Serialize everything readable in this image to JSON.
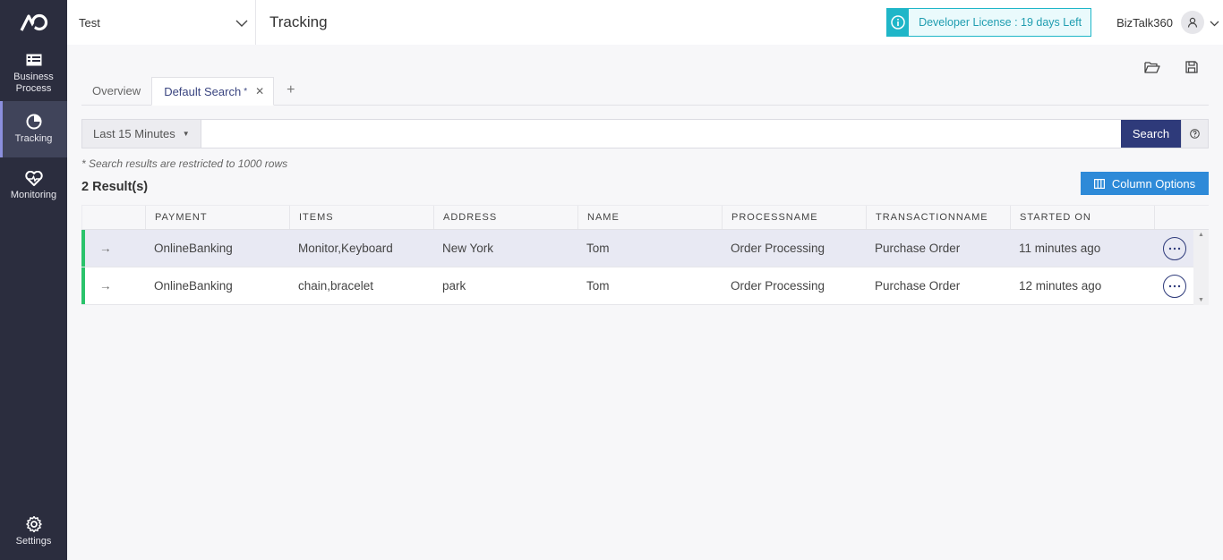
{
  "sidebar": {
    "items": [
      {
        "label": "Business Process",
        "icon": "business-process-icon",
        "active": false
      },
      {
        "label": "Tracking",
        "icon": "tracking-icon",
        "active": true
      },
      {
        "label": "Monitoring",
        "icon": "monitoring-icon",
        "active": false
      }
    ],
    "settings_label": "Settings"
  },
  "header": {
    "environment": "Test",
    "title": "Tracking",
    "license": "Developer License : 19 days Left",
    "user": "BizTalk360"
  },
  "tabs": {
    "overview": "Overview",
    "default_search": "Default Search",
    "modified_marker": "*",
    "add": "+"
  },
  "search": {
    "time_range": "Last 15 Minutes",
    "query": "",
    "button": "Search"
  },
  "note": "* Search results are restricted to 1000 rows",
  "results_count": "2 Result(s)",
  "column_options_label": "Column Options",
  "table": {
    "columns": [
      "PAYMENT",
      "ITEMS",
      "ADDRESS",
      "NAME",
      "PROCESSNAME",
      "TRANSACTIONNAME",
      "STARTED ON"
    ],
    "rows": [
      [
        "OnlineBanking",
        "Monitor,Keyboard",
        "New York",
        "Tom",
        "Order Processing",
        "Purchase Order",
        "11 minutes ago"
      ],
      [
        "OnlineBanking",
        "chain,bracelet",
        "park",
        "Tom",
        "Order Processing",
        "Purchase Order",
        "12 minutes ago"
      ]
    ]
  },
  "colors": {
    "sidebar_bg": "#2b2d3e",
    "accent": "#2e3a7a",
    "column_options_bg": "#2e8ad8",
    "license_border": "#1fb6c8",
    "status_green": "#2ac36b"
  }
}
